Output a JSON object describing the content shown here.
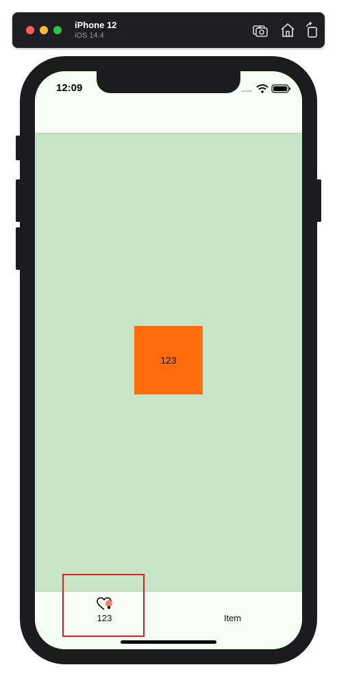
{
  "simulator": {
    "device_name": "iPhone 12",
    "os_version": "iOS 14.4",
    "toolbar_icons": [
      "screenshot-icon",
      "home-icon",
      "rotate-icon"
    ]
  },
  "status_bar": {
    "time": "12:09",
    "icons": [
      "signal-icon",
      "wifi-icon",
      "battery-icon"
    ]
  },
  "content": {
    "box_label": "123",
    "background_color": "#c6e4c6",
    "box_color": "#fe6c0b"
  },
  "tab_bar": {
    "items": [
      {
        "label": "123",
        "icon": "heart-badge-icon",
        "selected": true
      },
      {
        "label": "Item",
        "icon": "",
        "selected": false
      }
    ]
  },
  "annotation": {
    "highlight_color": "#e21b1b"
  }
}
